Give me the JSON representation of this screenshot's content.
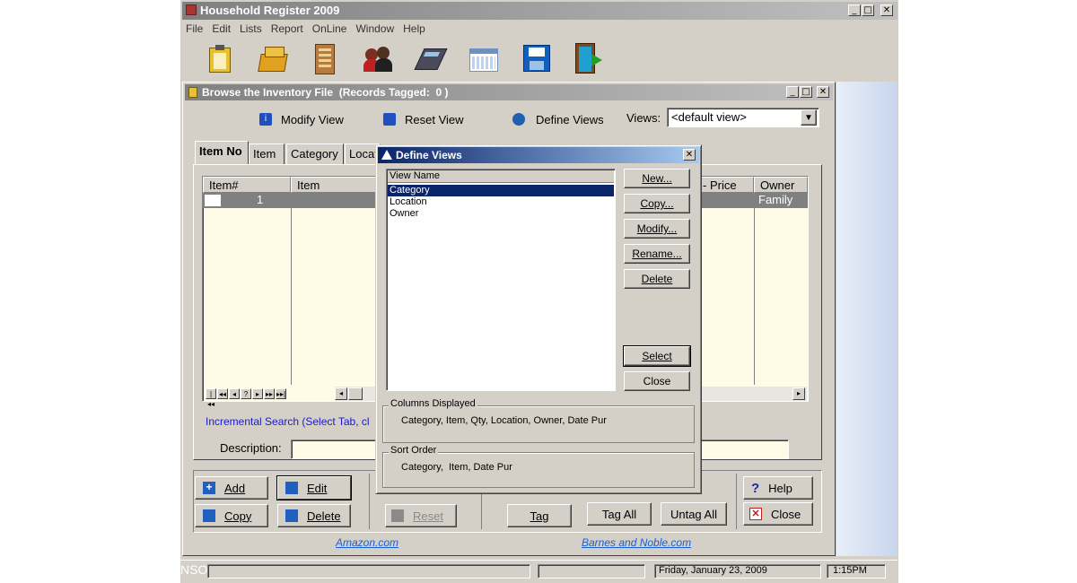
{
  "app": {
    "title": "Household Register 2009",
    "menu": [
      "File",
      "Edit",
      "Lists",
      "Report",
      "OnLine",
      "Window",
      "Help"
    ],
    "toolbar_icons": [
      "clipboard-icon",
      "file-cabinet-icon",
      "building-icon",
      "people-icon",
      "calculator-icon",
      "calendar-icon",
      "floppy-disk-icon",
      "exit-door-icon"
    ]
  },
  "browse": {
    "title": "Browse the Inventory File  (Records Tagged:  0 )",
    "modify_view": "Modify View",
    "reset_view": "Reset View",
    "define_views": "Define Views",
    "views_label": "Views:",
    "views_value": "<default view>",
    "tabs": [
      "Item No",
      "Item",
      "Category",
      "Locat"
    ],
    "columns": [
      "Item#",
      "Item",
      "- Price",
      "Owner"
    ],
    "row1": {
      "itemno": "1",
      "owner": "Family"
    },
    "incremental": "Incremental Search (Select Tab, cl",
    "description_label": "Description:",
    "buttons": {
      "add": "Add",
      "copy": "Copy",
      "edit": "Edit",
      "delete": "Delete",
      "reset": "Reset",
      "tag": "Tag",
      "tag_all": "Tag All",
      "untag_all": "Untag All",
      "help": "Help",
      "close": "Close"
    },
    "amazon": "Amazon.com",
    "barnes": "Barnes and Noble.com"
  },
  "dialog": {
    "title": "Define Views",
    "list_header": "View Name",
    "views": [
      "Category",
      "Location",
      "Owner"
    ],
    "selected_index": 0,
    "buttons": {
      "new": "New...",
      "copy": "Copy...",
      "modify": "Modify...",
      "rename": "Rename...",
      "delete": "Delete",
      "select": "Select",
      "close": "Close"
    },
    "columns_label": "Columns Displayed",
    "columns_value": "Category, Item, Qty, Location, Owner, Date Pur",
    "sort_label": "Sort Order",
    "sort_value": "Category,  Item, Date Pur"
  },
  "status": {
    "left": "NSO",
    "date": "Friday, January 23, 2009",
    "time": "1:15PM"
  },
  "colors": {
    "titlebar_active": "#0a246a",
    "titlebar_inactive": "#808080",
    "face": "#d4d0c8",
    "grid_bg": "#fefbe7",
    "link": "#1a5fd0",
    "search_text": "#1a1acc"
  }
}
